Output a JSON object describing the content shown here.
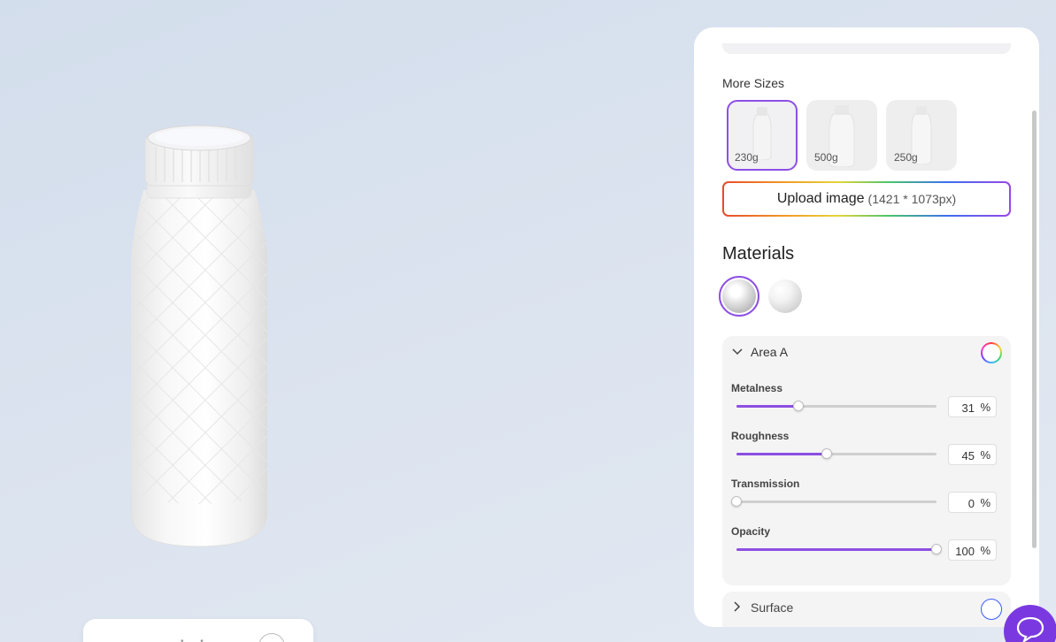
{
  "more_sizes": {
    "label": "More Sizes",
    "options": [
      {
        "label": "230g",
        "selected": true
      },
      {
        "label": "500g",
        "selected": false
      },
      {
        "label": "250g",
        "selected": false
      }
    ]
  },
  "upload": {
    "label": "Upload image",
    "dimensions": "(1421 * 1073px)"
  },
  "materials": {
    "title": "Materials",
    "swatches": [
      {
        "name": "glossy",
        "selected": true
      },
      {
        "name": "matte",
        "selected": false
      }
    ]
  },
  "area_a": {
    "title": "Area A",
    "expanded": true,
    "sliders": [
      {
        "label": "Metalness",
        "value": "31",
        "unit": "%",
        "fraction": 0.31
      },
      {
        "label": "Roughness",
        "value": "45",
        "unit": "%",
        "fraction": 0.45
      },
      {
        "label": "Transmission",
        "value": "0",
        "unit": "%",
        "fraction": 0.0
      },
      {
        "label": "Opacity",
        "value": "100",
        "unit": "%",
        "fraction": 1.0
      }
    ]
  },
  "surface": {
    "title": "Surface",
    "expanded": false
  },
  "colors": {
    "accent": "#8d4fe6",
    "chat_button": "#7a39e0",
    "panel_bg": "#ffffff",
    "card_bg": "#f4f4f5"
  },
  "icons": {
    "chevron_down": "chevron-down-icon",
    "color_picker": "color-wheel-icon",
    "chat": "chat-bubble-icon"
  }
}
